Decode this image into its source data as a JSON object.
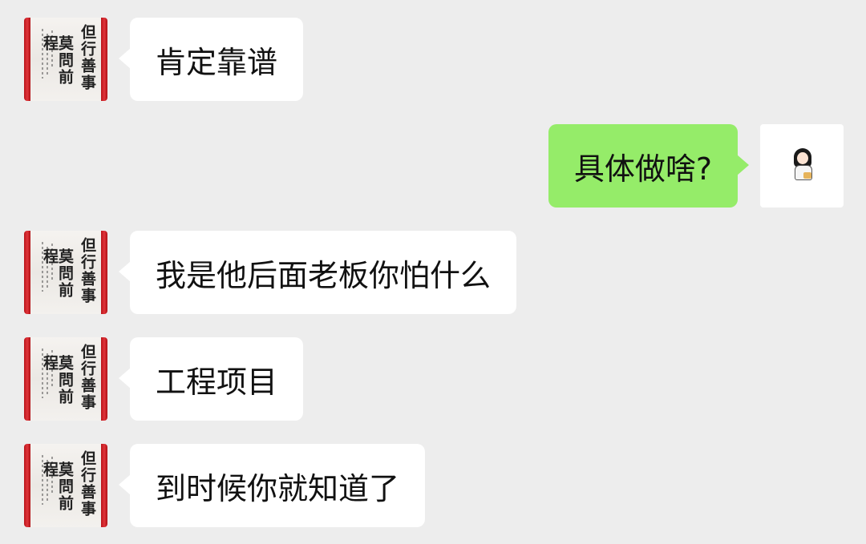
{
  "messages": [
    {
      "side": "left",
      "text": "肯定靠谱"
    },
    {
      "side": "right",
      "text": "具体做啥?"
    },
    {
      "side": "left",
      "text": "我是他后面老板你怕什么"
    },
    {
      "side": "left",
      "text": "工程项目"
    },
    {
      "side": "left",
      "text": "到时候你就知道了"
    }
  ],
  "avatar_left": {
    "calligraphy_col1": "但行善事",
    "calligraphy_col2": "莫問前程"
  },
  "colors": {
    "background": "#ededed",
    "bubble_incoming": "#ffffff",
    "bubble_outgoing": "#95ec69",
    "scroll_rod": "#d2232a"
  },
  "icons": {
    "left_avatar": "calligraphy-scroll-avatar",
    "right_avatar": "cartoon-girl-avatar"
  }
}
